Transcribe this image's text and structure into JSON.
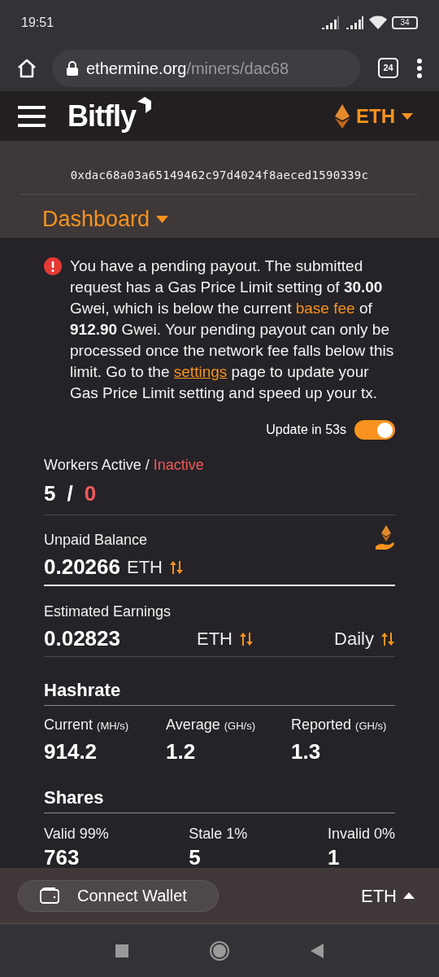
{
  "status_bar": {
    "time": "19:51",
    "battery": "34"
  },
  "browser": {
    "url_host": "ethermine.org",
    "url_path": "/miners/dac68",
    "tab_count": "24"
  },
  "header": {
    "logo": "Bitfly",
    "currency": "ETH"
  },
  "miner": {
    "address": "0xdac68a03a65149462c97d4024f8aeced1590339c",
    "page": "Dashboard"
  },
  "alert": {
    "segments": [
      {
        "kind": "text",
        "text": "You have a pending payout. The submitted request has a Gas Price Limit setting of "
      },
      {
        "kind": "bold",
        "text": "30.00"
      },
      {
        "kind": "text",
        "text": " Gwei, which is below the current "
      },
      {
        "kind": "highlight",
        "text": "base fee"
      },
      {
        "kind": "text",
        "text": " of "
      },
      {
        "kind": "bold",
        "text": "912.90"
      },
      {
        "kind": "text",
        "text": " Gwei. Your pending payout can only be processed once the network fee falls below this limit. Go to the "
      },
      {
        "kind": "link",
        "text": "settings"
      },
      {
        "kind": "text",
        "text": " page to update your Gas Price Limit setting and speed up your tx."
      }
    ]
  },
  "auto_update": {
    "label": "Update in 53s",
    "on": true
  },
  "workers": {
    "label_active": "Workers Active /",
    "label_inactive": "Inactive",
    "active": "5",
    "separator": "/",
    "inactive": "0"
  },
  "unpaid": {
    "label": "Unpaid Balance",
    "value": "0.20266",
    "unit": "ETH"
  },
  "earnings": {
    "label": "Estimated Earnings",
    "value": "0.02823",
    "unit": "ETH",
    "period": "Daily"
  },
  "hashrate": {
    "title": "Hashrate",
    "items": [
      {
        "label": "Current",
        "unit": "(MH/s)",
        "value": "914.2"
      },
      {
        "label": "Average",
        "unit": "(GH/s)",
        "value": "1.2"
      },
      {
        "label": "Reported",
        "unit": "(GH/s)",
        "value": "1.3"
      }
    ]
  },
  "shares": {
    "title": "Shares",
    "items": [
      {
        "label": "Valid 99%",
        "value": "763"
      },
      {
        "label": "Stale 1%",
        "value": "5"
      },
      {
        "label": "Invalid 0%",
        "value": "1"
      }
    ]
  },
  "bottom_bar": {
    "connect": "Connect Wallet",
    "currency": "ETH"
  }
}
